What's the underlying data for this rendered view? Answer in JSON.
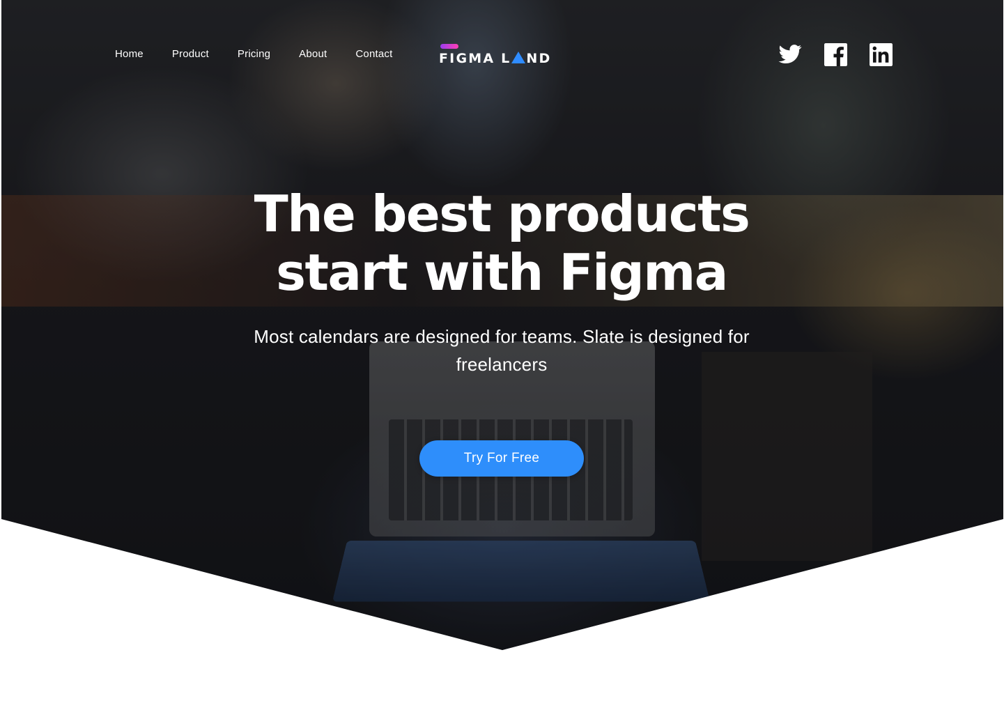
{
  "nav": {
    "items": [
      {
        "label": "Home"
      },
      {
        "label": "Product"
      },
      {
        "label": "Pricing"
      },
      {
        "label": "About"
      },
      {
        "label": "Contact"
      }
    ]
  },
  "logo": {
    "text_before": "FIGMA L",
    "text_after": "ND"
  },
  "socials": [
    {
      "icon": "twitter-icon"
    },
    {
      "icon": "facebook-icon"
    },
    {
      "icon": "linkedin-icon"
    }
  ],
  "hero": {
    "headline_line1": "The best products",
    "headline_line2": "start with Figma",
    "subline": "Most calendars are designed for teams. Slate is designed for freelancers",
    "cta_label": "Try For Free"
  },
  "colors": {
    "accent": "#2e8efb",
    "logo_gradient_start": "#9b3df0",
    "logo_gradient_end": "#ff3fb3",
    "text": "#ffffff"
  }
}
